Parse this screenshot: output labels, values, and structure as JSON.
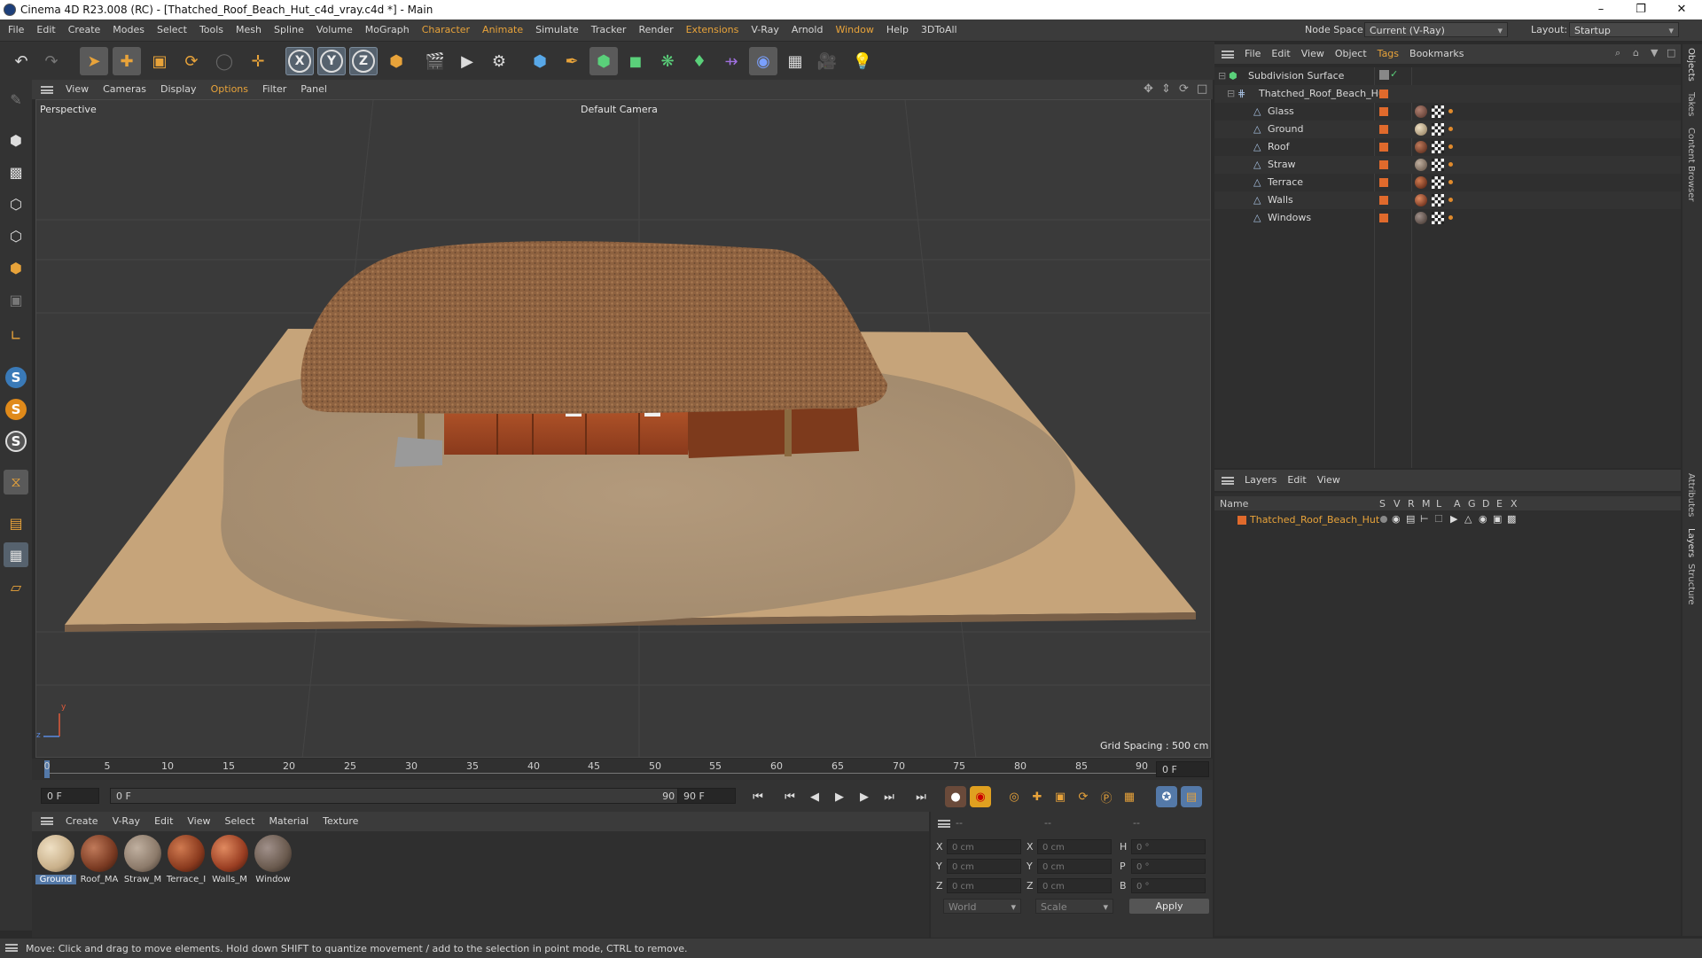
{
  "window": {
    "title": "Cinema 4D R23.008 (RC) - [Thatched_Roof_Beach_Hut_c4d_vray.c4d *] - Main",
    "minimize": "–",
    "maximize": "❐",
    "close": "✕"
  },
  "menubar": {
    "items": [
      "File",
      "Edit",
      "Create",
      "Modes",
      "Select",
      "Tools",
      "Mesh",
      "Spline",
      "Volume",
      "MoGraph",
      "Character",
      "Animate",
      "Simulate",
      "Tracker",
      "Render",
      "Extensions",
      "V-Ray",
      "Arnold",
      "Window",
      "Help",
      "3DToAll"
    ],
    "node_space_label": "Node Space:",
    "node_space_value": "Current (V-Ray)",
    "layout_label": "Layout:",
    "layout_value": "Startup"
  },
  "toolbar": {
    "axis_x": "X",
    "axis_y": "Y",
    "axis_z": "Z"
  },
  "left_toolbar": {
    "s1": "S",
    "s2": "S",
    "s3": "S"
  },
  "viewport": {
    "menu": [
      "View",
      "Cameras",
      "Display",
      "Options",
      "Filter",
      "Panel"
    ],
    "label": "Perspective",
    "camera": "Default Camera",
    "grid_spacing": "Grid Spacing : 500 cm",
    "axis_y": "y",
    "axis_z": "z"
  },
  "timeline": {
    "ticks": [
      "0",
      "5",
      "10",
      "15",
      "20",
      "25",
      "30",
      "35",
      "40",
      "45",
      "50",
      "55",
      "60",
      "65",
      "70",
      "75",
      "80",
      "85",
      "90"
    ],
    "current_frame_right": "0 F"
  },
  "transport": {
    "start_field": "0 F",
    "range_start": "0 F",
    "range_end": "90 F",
    "end_field": "90 F"
  },
  "material_manager": {
    "menu": [
      "Create",
      "V-Ray",
      "Edit",
      "View",
      "Select",
      "Material",
      "Texture"
    ],
    "materials": [
      {
        "label": "Ground",
        "color": "#c9b08a"
      },
      {
        "label": "Roof_MA",
        "color": "#7a3a22"
      },
      {
        "label": "Straw_M",
        "color": "#8c7a6a"
      },
      {
        "label": "Terrace_I",
        "color": "#8a3a1e"
      },
      {
        "label": "Walls_M",
        "color": "#9a3e22"
      },
      {
        "label": "Window",
        "color": "#6a5a4e"
      }
    ]
  },
  "coordinates": {
    "header_left": "--",
    "header_mid": "--",
    "header_right": "--",
    "rows": [
      {
        "l1": "X",
        "v1": "0 cm",
        "l2": "X",
        "v2": "0 cm",
        "l3": "H",
        "v3": "0 °"
      },
      {
        "l1": "Y",
        "v1": "0 cm",
        "l2": "Y",
        "v2": "0 cm",
        "l3": "P",
        "v3": "0 °"
      },
      {
        "l1": "Z",
        "v1": "0 cm",
        "l2": "Z",
        "v2": "0 cm",
        "l3": "B",
        "v3": "0 °"
      }
    ],
    "world": "World",
    "scale": "Scale",
    "apply": "Apply"
  },
  "object_manager": {
    "menu": [
      "File",
      "Edit",
      "View",
      "Object",
      "Tags",
      "Bookmarks"
    ],
    "root": "Subdivision Surface",
    "group": "Thatched_Roof_Beach_Hut",
    "children": [
      "Glass",
      "Ground",
      "Roof",
      "Straw",
      "Terrace",
      "Walls",
      "Windows"
    ]
  },
  "layer_manager": {
    "menu": [
      "Layers",
      "Edit",
      "View"
    ],
    "columns": [
      "Name",
      "S",
      "V",
      "R",
      "M",
      "L",
      "A",
      "G",
      "D",
      "E",
      "X"
    ],
    "layer": "Thatched_Roof_Beach_Hut"
  },
  "right_strip": [
    "Objects",
    "Takes",
    "Content Browser",
    "Attributes",
    "Layers",
    "Structure"
  ],
  "status": {
    "message": "Move: Click and drag to move elements. Hold down SHIFT to quantize movement / add to the selection in point mode, CTRL to remove."
  },
  "colors": {
    "accent_orange": "#e8a33a",
    "layer_orange": "#e06a2c",
    "selection_blue": "#5479a8"
  }
}
